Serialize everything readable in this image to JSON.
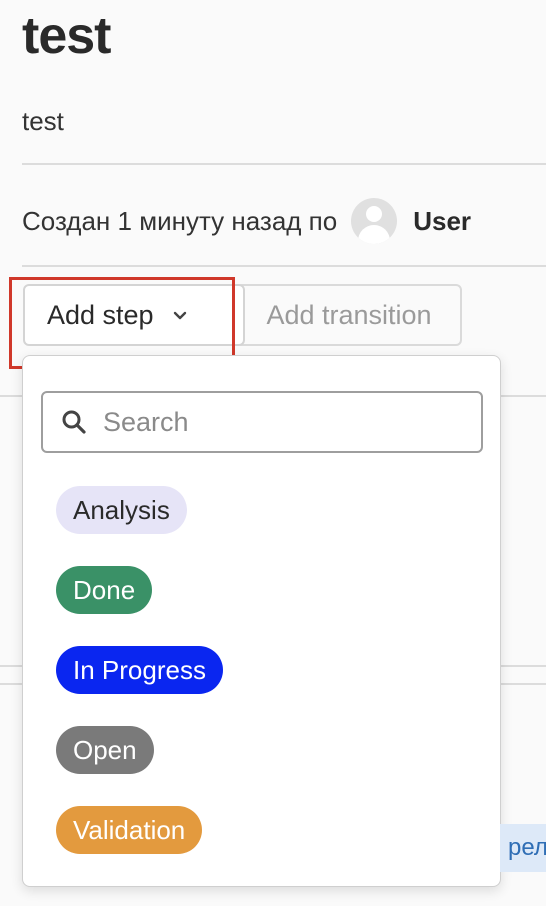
{
  "issue": {
    "title": "test",
    "description": "test",
    "created_text": "Создан 1 минуту назад по",
    "author": "User"
  },
  "actions": {
    "add_step_label": "Add step",
    "add_transition_label": "Add transition"
  },
  "dropdown": {
    "search_placeholder": "Search",
    "steps": [
      {
        "label": "Analysis",
        "bg": "#e6e4f7",
        "fg": "#2a2a2a"
      },
      {
        "label": "Done",
        "bg": "#3a9167",
        "fg": "#ffffff"
      },
      {
        "label": "In Progress",
        "bg": "#0a26f0",
        "fg": "#ffffff"
      },
      {
        "label": "Open",
        "bg": "#7a7a7a",
        "fg": "#ffffff"
      },
      {
        "label": "Validation",
        "bg": "#e39a3e",
        "fg": "#ffffff"
      }
    ]
  },
  "side_tag_text": "рел",
  "colors": {
    "highlight": "#d0382a"
  }
}
